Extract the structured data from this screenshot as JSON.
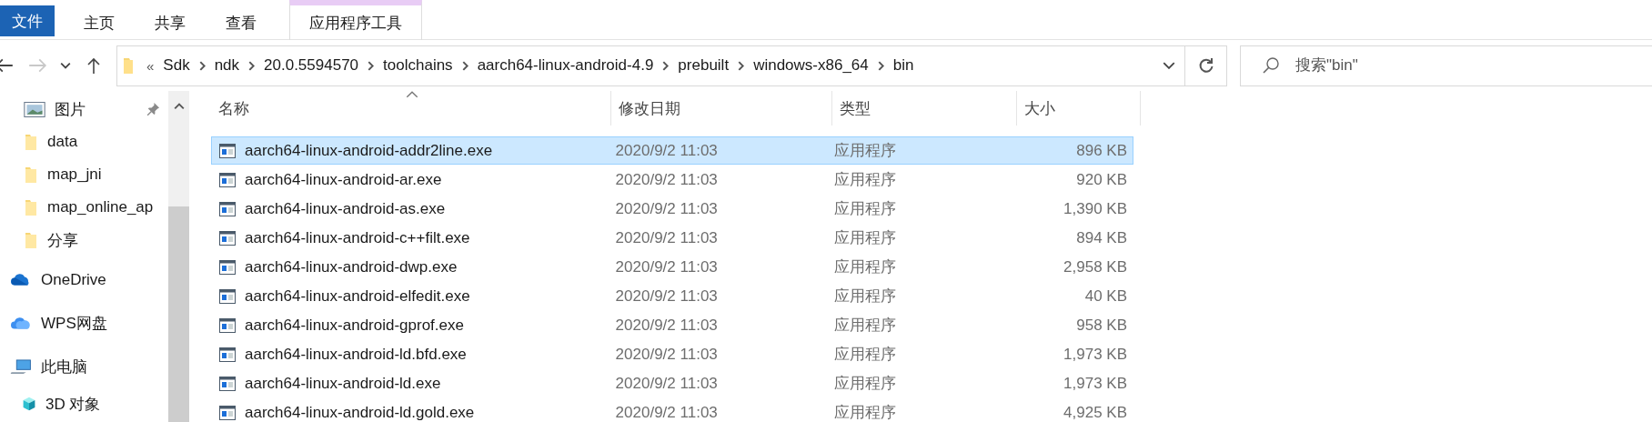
{
  "ribbon": {
    "file_button": "文件",
    "tabs": [
      {
        "label": "主页",
        "selected": false,
        "contextual": false
      },
      {
        "label": "共享",
        "selected": false,
        "contextual": false
      },
      {
        "label": "查看",
        "selected": false,
        "contextual": false
      },
      {
        "label": "应用程序工具",
        "selected": false,
        "contextual": true
      }
    ]
  },
  "navigation": {
    "buttons": [
      {
        "kind": "back",
        "disabled": false
      },
      {
        "kind": "forward",
        "disabled": true
      },
      {
        "kind": "recent",
        "disabled": false
      },
      {
        "kind": "up",
        "disabled": false
      }
    ],
    "address": {
      "overflow": "«",
      "path": [
        "Sdk",
        "ndk",
        "20.0.5594570",
        "toolchains",
        "aarch64-linux-android-4.9",
        "prebuilt",
        "windows-x86_64",
        "bin"
      ]
    },
    "search": {
      "placeholder": "搜索\"bin\""
    }
  },
  "sidebar": {
    "quick_access": [
      {
        "kind": "pictures",
        "label": "图片",
        "pinned": true
      },
      {
        "kind": "folder",
        "label": "data",
        "pinned": false
      },
      {
        "kind": "folder",
        "label": "map_jni",
        "pinned": false
      },
      {
        "kind": "folder",
        "label": "map_online_ap",
        "pinned": false
      },
      {
        "kind": "folder",
        "label": "分享",
        "pinned": false
      }
    ],
    "locations": [
      {
        "kind": "onedrive",
        "label": "OneDrive"
      },
      {
        "kind": "wps",
        "label": "WPS网盘"
      },
      {
        "kind": "pc",
        "label": "此电脑",
        "children": [
          {
            "kind": "cube",
            "label": "3D 对象"
          }
        ]
      }
    ]
  },
  "table": {
    "columns": [
      "名称",
      "修改日期",
      "类型",
      "大小"
    ],
    "rows": [
      {
        "name": "aarch64-linux-android-addr2line.exe",
        "modified": "2020/9/2 11:03",
        "type": "应用程序",
        "size": "896 KB",
        "selected": true
      },
      {
        "name": "aarch64-linux-android-ar.exe",
        "modified": "2020/9/2 11:03",
        "type": "应用程序",
        "size": "920 KB",
        "selected": false
      },
      {
        "name": "aarch64-linux-android-as.exe",
        "modified": "2020/9/2 11:03",
        "type": "应用程序",
        "size": "1,390 KB",
        "selected": false
      },
      {
        "name": "aarch64-linux-android-c++filt.exe",
        "modified": "2020/9/2 11:03",
        "type": "应用程序",
        "size": "894 KB",
        "selected": false
      },
      {
        "name": "aarch64-linux-android-dwp.exe",
        "modified": "2020/9/2 11:03",
        "type": "应用程序",
        "size": "2,958 KB",
        "selected": false
      },
      {
        "name": "aarch64-linux-android-elfedit.exe",
        "modified": "2020/9/2 11:03",
        "type": "应用程序",
        "size": "40 KB",
        "selected": false
      },
      {
        "name": "aarch64-linux-android-gprof.exe",
        "modified": "2020/9/2 11:03",
        "type": "应用程序",
        "size": "958 KB",
        "selected": false
      },
      {
        "name": "aarch64-linux-android-ld.bfd.exe",
        "modified": "2020/9/2 11:03",
        "type": "应用程序",
        "size": "1,973 KB",
        "selected": false
      },
      {
        "name": "aarch64-linux-android-ld.exe",
        "modified": "2020/9/2 11:03",
        "type": "应用程序",
        "size": "1,973 KB",
        "selected": false
      },
      {
        "name": "aarch64-linux-android-ld.gold.exe",
        "modified": "2020/9/2 11:03",
        "type": "应用程序",
        "size": "4,925 KB",
        "selected": false
      }
    ]
  }
}
